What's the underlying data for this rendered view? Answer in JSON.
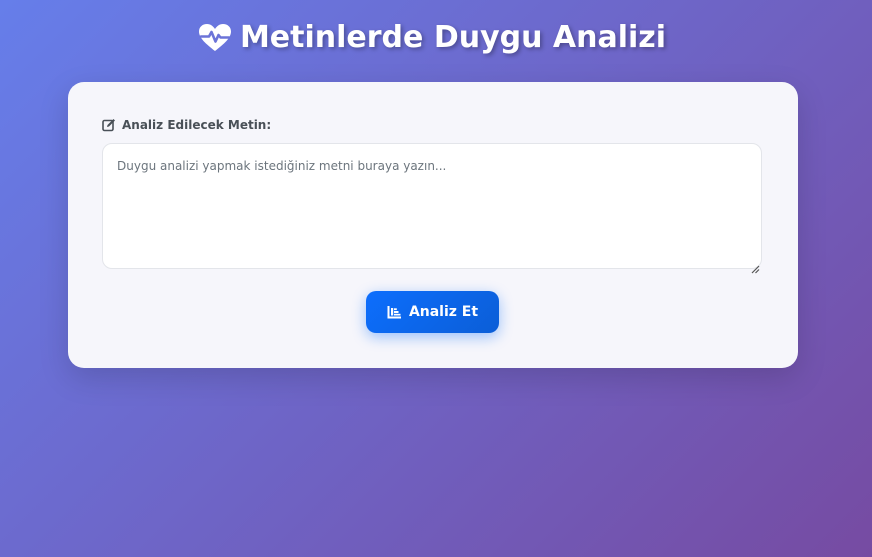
{
  "header": {
    "title": "Metinlerde Duygu Analizi",
    "icon": "heart-pulse-icon"
  },
  "form": {
    "label": "Analiz Edilecek Metin:",
    "label_icon": "edit-icon",
    "textarea_value": "",
    "textarea_placeholder": "Duygu analizi yapmak istediğiniz metni buraya yazın...",
    "submit_label": "Analiz Et",
    "submit_icon": "chart-bar-icon"
  },
  "colors": {
    "background_start": "#667eea",
    "background_end": "#764ba2",
    "button": "#0d6efd",
    "card": "#f6f6fb"
  }
}
